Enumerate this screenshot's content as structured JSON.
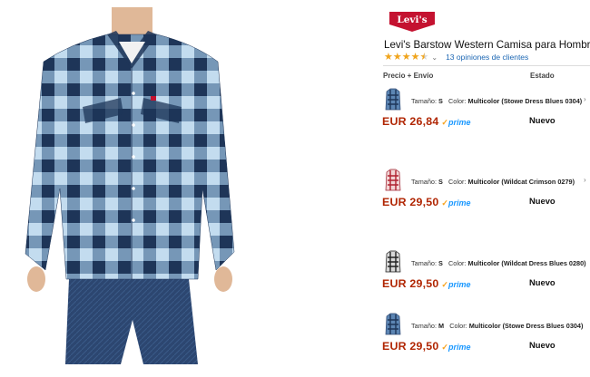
{
  "brand": {
    "logo_text": "Levi's"
  },
  "product": {
    "title": "Levi's Barstow Western Camisa para Hombre",
    "rating": 4.5,
    "reviews_text": "13 opiniones de clientes"
  },
  "columns": {
    "price": "Precio + Envío",
    "condition": "Estado"
  },
  "offers": [
    {
      "size_label": "Tamaño:",
      "size": "S",
      "color_label": "Color:",
      "color": "Multicolor (Stowe Dress Blues 0304)",
      "price": "EUR 26,84",
      "prime": "prime",
      "condition": "Nuevo",
      "thumb": "shirt-blue"
    },
    {
      "size_label": "Tamaño:",
      "size": "S",
      "color_label": "Color:",
      "color": "Multicolor (Wildcat Crimson 0279)",
      "price": "EUR 29,50",
      "prime": "prime",
      "condition": "Nuevo",
      "thumb": "shirt-red"
    },
    {
      "size_label": "Tamaño:",
      "size": "S",
      "color_label": "Color:",
      "color": "Multicolor (Wildcat Dress Blues 0280)",
      "price": "EUR 29,50",
      "prime": "prime",
      "condition": "Nuevo",
      "thumb": "shirt-navy"
    },
    {
      "size_label": "Tamaño:",
      "size": "M",
      "color_label": "Color:",
      "color": "Multicolor (Stowe Dress Blues 0304)",
      "price": "EUR 29,50",
      "prime": "prime",
      "condition": "Nuevo",
      "thumb": "shirt-blue"
    }
  ],
  "colors": {
    "price": "#b12704",
    "prime": "#1a98ff",
    "star": "#f0a41c",
    "link": "#1b66b3",
    "logo_red": "#c41230"
  }
}
